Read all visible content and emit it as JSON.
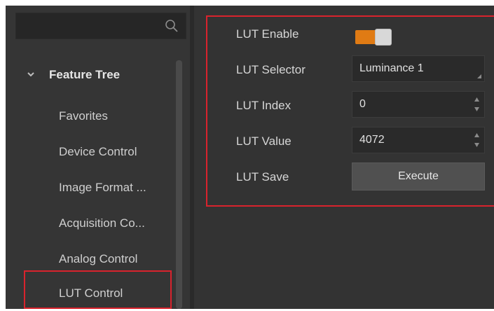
{
  "search": {
    "placeholder": ""
  },
  "tree": {
    "header": "Feature Tree",
    "items": [
      {
        "label": "Favorites"
      },
      {
        "label": "Device Control"
      },
      {
        "label": "Image Format ..."
      },
      {
        "label": "Acquisition Co..."
      },
      {
        "label": "Analog Control"
      },
      {
        "label": "LUT Control"
      }
    ]
  },
  "properties": {
    "lut_enable": {
      "label": "LUT Enable",
      "value": "on"
    },
    "lut_selector": {
      "label": "LUT Selector",
      "value": "Luminance 1"
    },
    "lut_index": {
      "label": "LUT Index",
      "value": "0"
    },
    "lut_value": {
      "label": "LUT Value",
      "value": "4072"
    },
    "lut_save": {
      "label": "LUT Save",
      "button": "Execute"
    }
  },
  "colors": {
    "accent": "#e07b14",
    "highlight": "#d9232d",
    "panel": "#333333"
  }
}
